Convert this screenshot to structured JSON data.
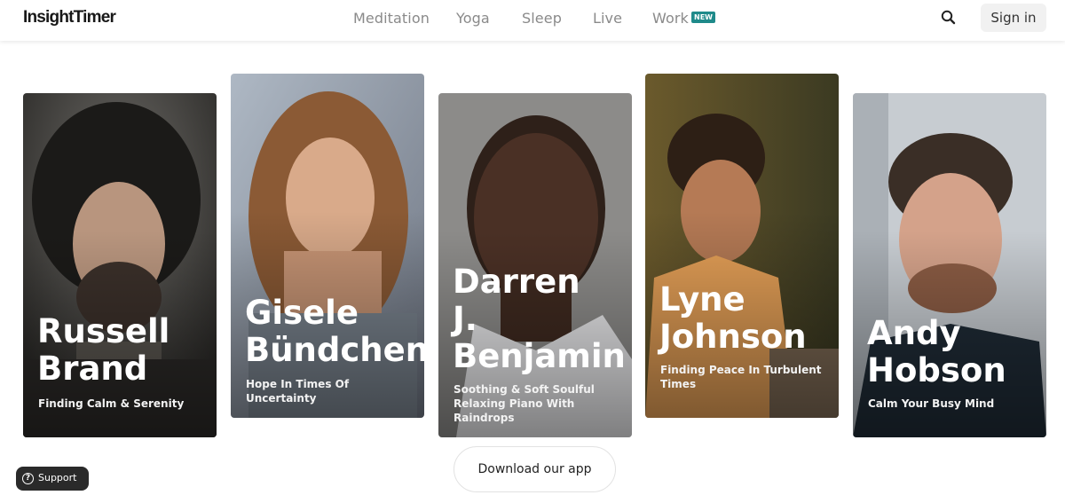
{
  "header": {
    "logo": "InsightTimer",
    "nav": [
      {
        "label": "Meditation"
      },
      {
        "label": "Yoga"
      },
      {
        "label": "Sleep"
      },
      {
        "label": "Live"
      },
      {
        "label": "Work",
        "badge": "NEW"
      }
    ],
    "search_icon": "search-icon",
    "signin_label": "Sign in"
  },
  "cards": [
    {
      "name": "Russell\nBrand",
      "subtitle": "Finding Calm & Serenity"
    },
    {
      "name": "Gisele\nBündchen",
      "subtitle": "Hope In Times Of Uncertainty"
    },
    {
      "name": "Darren\nJ.\nBenjamin",
      "subtitle": "Soothing & Soft Soulful Relaxing Piano With Raindrops"
    },
    {
      "name": "Lyne\nJohnson",
      "subtitle": "Finding Peace In Turbulent Times"
    },
    {
      "name": "Andy\nHobson",
      "subtitle": "Calm Your Busy Mind"
    }
  ],
  "download_label": "Download our app",
  "support": {
    "icon": "help-circle-icon",
    "label": "Support"
  },
  "colors": {
    "badge": "#1f8a8a",
    "nav_text": "#8a8a8a",
    "support_bg": "#2a2a2a"
  }
}
